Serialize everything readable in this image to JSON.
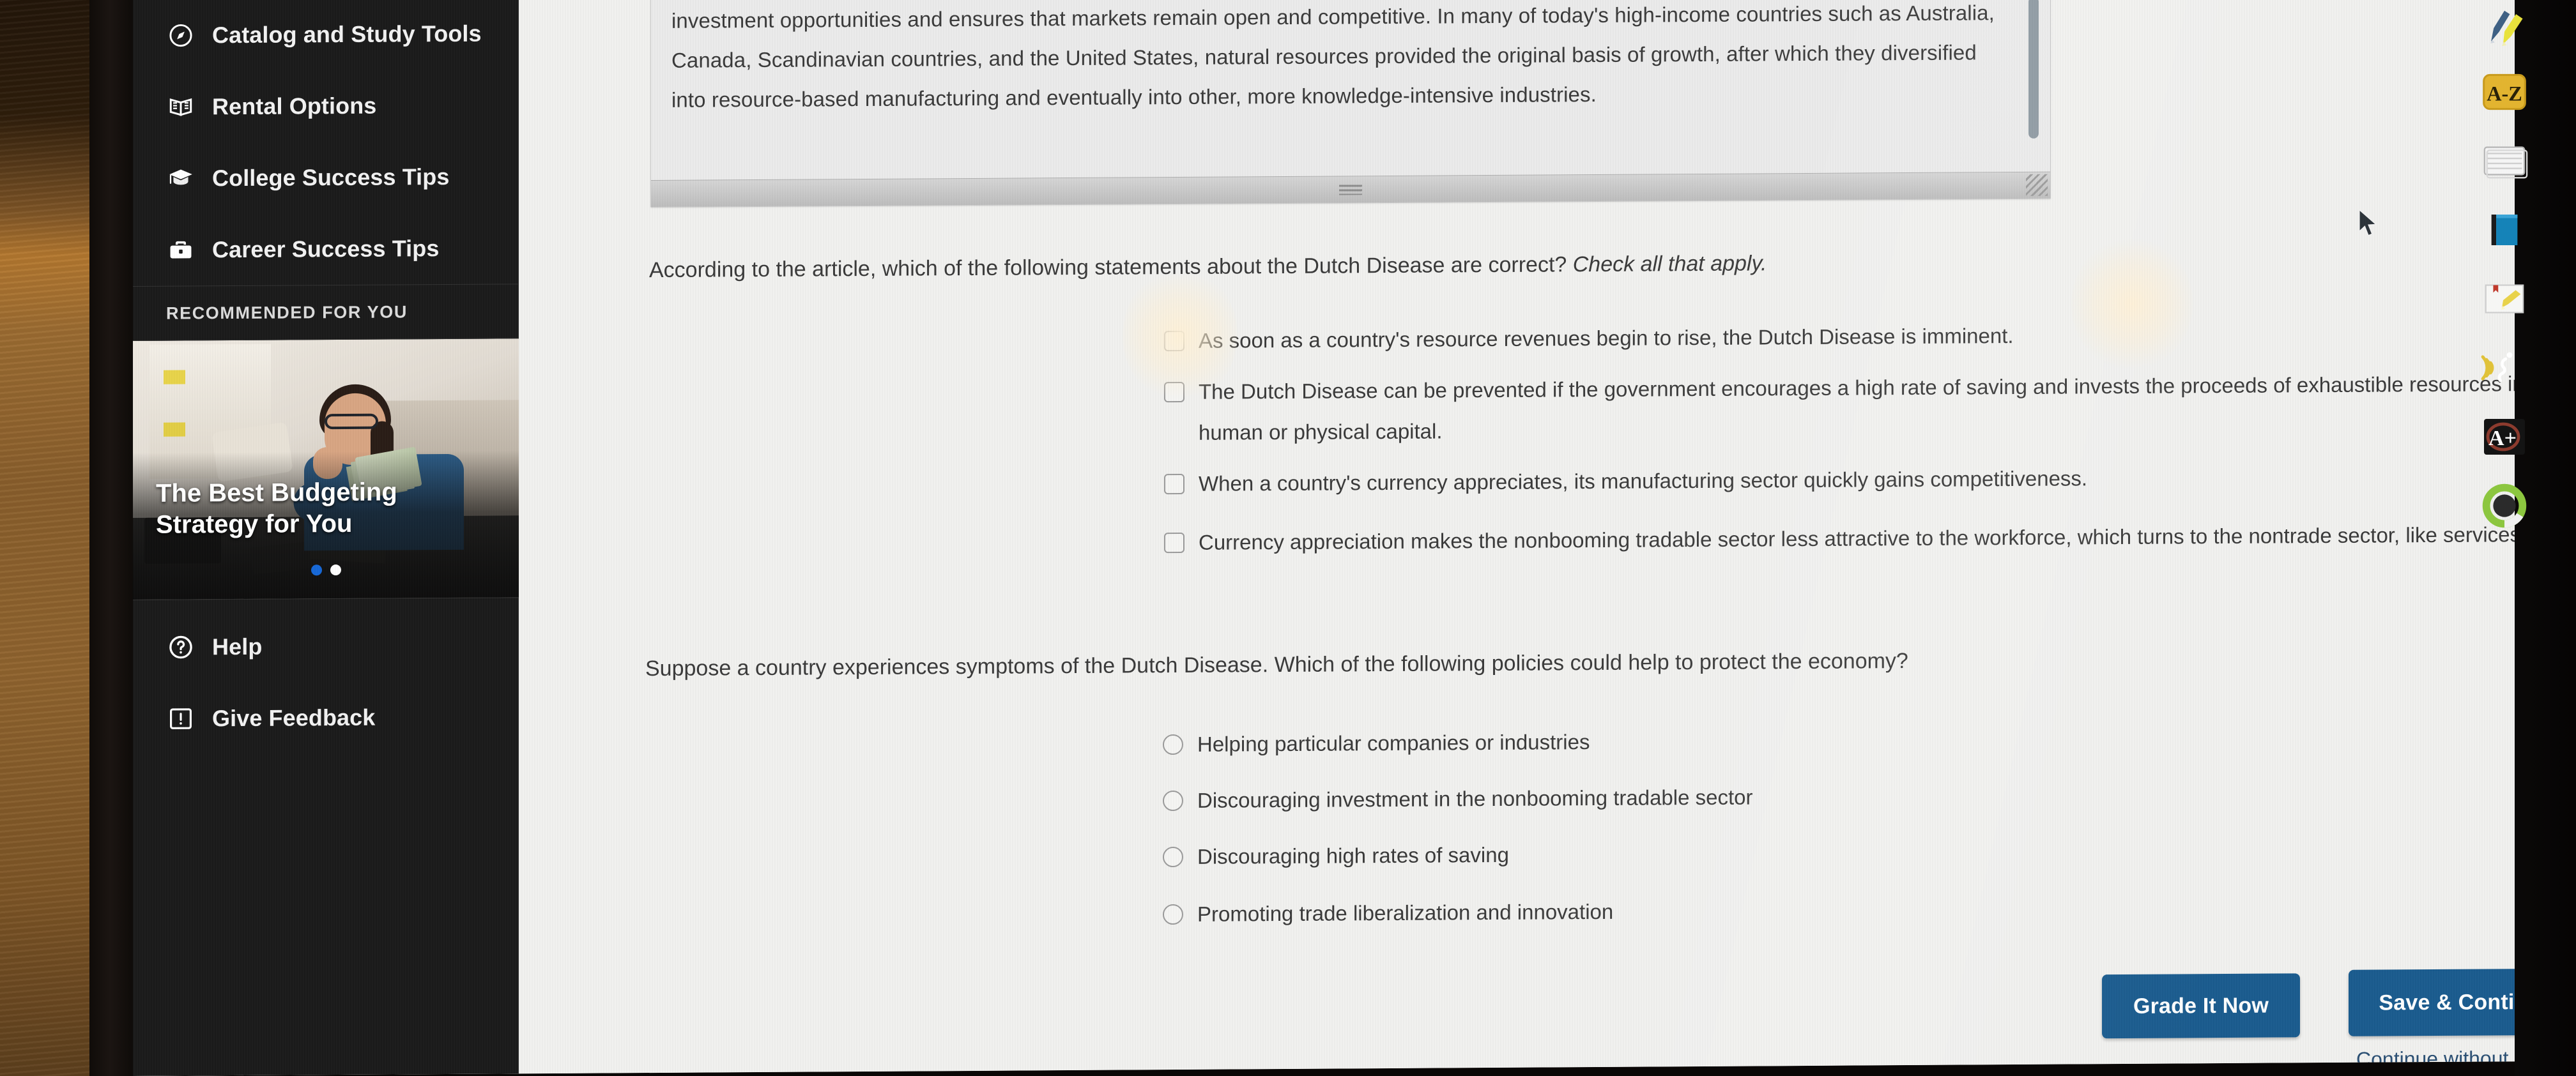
{
  "sidebar": {
    "nav_items": [
      {
        "label": "Catalog and Study Tools",
        "icon": "compass-icon"
      },
      {
        "label": "Rental Options",
        "icon": "open-book-icon"
      },
      {
        "label": "College Success Tips",
        "icon": "graduation-cap-icon"
      },
      {
        "label": "Career Success Tips",
        "icon": "briefcase-icon"
      }
    ],
    "recommended_header": "RECOMMENDED FOR YOU",
    "recommended_card": {
      "title": "The Best Budgeting Strategy for You",
      "carousel_dots": 2,
      "active_dot": 0
    },
    "footer_items": [
      {
        "label": "Help",
        "icon": "question-circle-icon"
      },
      {
        "label": "Give Feedback",
        "icon": "feedback-exclamation-icon"
      }
    ]
  },
  "article": {
    "excerpt": "is not to grant subsidies and protection but rather to create a healthy business environment that facilitates the discovery of profitable investment opportunities and ensures that markets remain open and competitive. In many of today's high-income countries such as Australia, Canada, Scandinavian countries, and the United States, natural resources provided the original basis of growth, after which they diversified into resource-based manufacturing and eventually into other, more knowledge-intensive industries."
  },
  "question_1": {
    "prompt_main": "According to the article, which of the following statements about the Dutch Disease are correct? ",
    "prompt_italic": "Check all that apply.",
    "type": "checkbox",
    "options": [
      "As soon as a country's resource revenues begin to rise, the Dutch Disease is imminent.",
      "The Dutch Disease can be prevented if the government encourages a high rate of saving and invests the proceeds of exhaustible resources in human or physical capital.",
      "When a country's currency appreciates, its manufacturing sector quickly gains competitiveness.",
      "Currency appreciation makes the nonbooming tradable sector less attractive to the workforce, which turns to the nontrade sector, like services."
    ],
    "checked": [
      false,
      false,
      false,
      false
    ]
  },
  "question_2": {
    "prompt": "Suppose a country experiences symptoms of the Dutch Disease. Which of the following policies could help to protect the economy?",
    "type": "radio",
    "options": [
      "Helping particular companies or industries",
      "Discouraging investment in the nonbooming tradable sector",
      "Discouraging high rates of saving",
      "Promoting trade liberalization and innovation"
    ],
    "selected": null
  },
  "actions": {
    "grade_label": "Grade It Now",
    "save_label": "Save & Continue",
    "continue_link": "Continue without saving",
    "button_color": "#1b5c8f"
  },
  "toolrail": {
    "items": [
      {
        "name": "pen-highlighter-icon"
      },
      {
        "name": "glossary-a-z-icon",
        "label": "A-Z"
      },
      {
        "name": "flashcards-icon"
      },
      {
        "name": "ebook-icon"
      },
      {
        "name": "note-highlight-icon"
      },
      {
        "name": "read-aloud-icon"
      },
      {
        "name": "grade-a-plus-icon",
        "label": "A+"
      },
      {
        "name": "progress-ring-icon"
      }
    ]
  }
}
